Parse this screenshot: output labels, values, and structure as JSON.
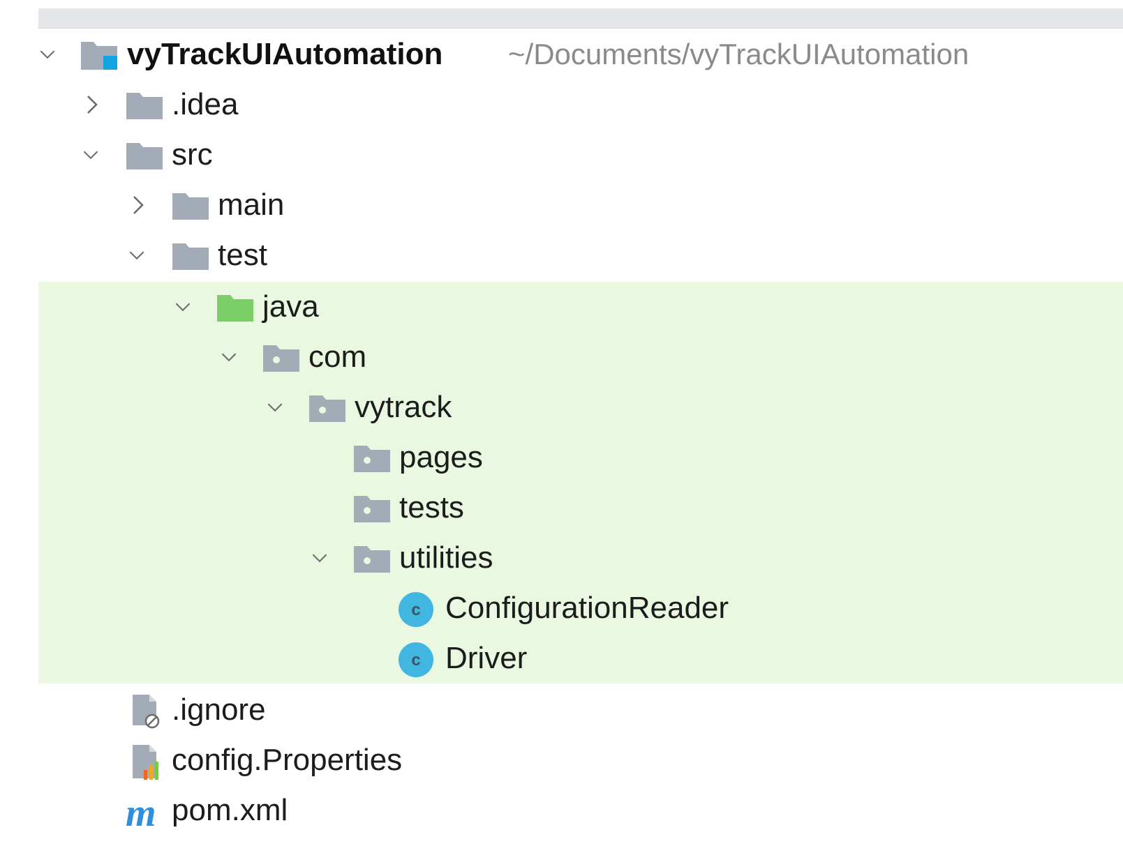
{
  "project": {
    "name": "vyTrackUIAutomation",
    "path": "~/Documents/vyTrackUIAutomation"
  },
  "tree": {
    "idea": ".idea",
    "src": "src",
    "main": "main",
    "test": "test",
    "java": "java",
    "com": "com",
    "vytrack": "vytrack",
    "pages": "pages",
    "tests": "tests",
    "utilities": "utilities",
    "configuration_reader": "ConfigurationReader",
    "driver": "Driver",
    "ignore": ".ignore",
    "config_properties": "config.Properties",
    "pom": "pom.xml"
  },
  "icons": {
    "chevron_down": "chevron-down-icon",
    "chevron_right": "chevron-right-icon",
    "folder": "folder-icon",
    "source_folder": "source-root-folder-icon",
    "package": "package-icon",
    "class": "java-class-icon",
    "ignore_file": "ignore-file-icon",
    "properties_file": "properties-file-icon",
    "maven_file": "maven-pom-icon",
    "module": "module-icon"
  },
  "colors": {
    "folder_gray": "#a3acb6",
    "source_green": "#7ccf68",
    "class_cyan": "#40b6e0",
    "highlight": "#eaf8e2",
    "module_blue": "#14a3e3",
    "maven_blue": "#2f8fdd"
  }
}
